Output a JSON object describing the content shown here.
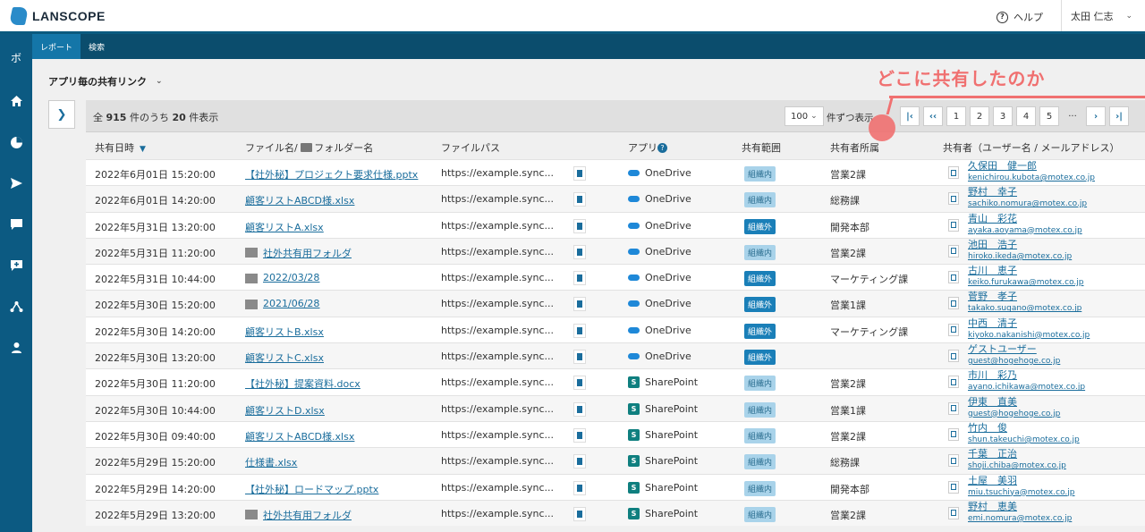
{
  "header": {
    "brand": "LANSCOPE",
    "help_label": "ヘルプ",
    "user_name": "太田 仁志"
  },
  "sidebar": {
    "top_label": "ボ",
    "items": [
      "home-icon",
      "chart-icon",
      "send-icon",
      "chat-icon",
      "add-comment-icon",
      "network-icon",
      "person-icon"
    ]
  },
  "subnav": {
    "tabs": [
      {
        "label": "レポート",
        "active": true
      },
      {
        "label": "検索",
        "active": false
      }
    ]
  },
  "page": {
    "title": "アプリ毎の共有リンク",
    "count_prefix": "全",
    "total": "915",
    "count_middle": "件のうち",
    "shown": "20",
    "count_suffix": "件表示",
    "per_page": "100",
    "per_page_label": "件ずつ表示",
    "pages": [
      "1",
      "2",
      "3",
      "4",
      "5"
    ],
    "ellipsis": "···"
  },
  "callout": {
    "text": "どこに共有したのか",
    "color": "#f07070"
  },
  "table": {
    "headers": {
      "date": "共有日時",
      "file": "ファイル名/",
      "folder": "フォルダー名",
      "path": "ファイルパス",
      "app": "アプリ",
      "scope": "共有範囲",
      "dept": "共有者所属",
      "sharer": "共有者（ユーザー名 / メールアドレス）"
    },
    "rows": [
      {
        "date": "2022年6月01日 15:20:00",
        "file": "【社外秘】プロジェクト要求仕様.pptx",
        "folder": false,
        "path": "https://example.sync...",
        "app": "OneDrive",
        "scope": "組織内",
        "dept": "営業2課",
        "name": "久保田　健一郎",
        "mail": "kenichirou.kubota@motex.co.jp"
      },
      {
        "date": "2022年6月01日 14:20:00",
        "file": "顧客リストABCD様.xlsx",
        "folder": false,
        "path": "https://example.sync...",
        "app": "OneDrive",
        "scope": "組織内",
        "dept": "総務課",
        "name": "野村　幸子",
        "mail": "sachiko.nomura@motex.co.jp"
      },
      {
        "date": "2022年5月31日 13:20:00",
        "file": "顧客リストA.xlsx",
        "folder": false,
        "path": "https://example.sync...",
        "app": "OneDrive",
        "scope": "組織外",
        "dept": "開発本部",
        "name": "青山　彩花",
        "mail": "ayaka.aoyama@motex.co.jp"
      },
      {
        "date": "2022年5月31日 11:20:00",
        "file": "社外共有用フォルダ",
        "folder": true,
        "path": "https://example.sync...",
        "app": "OneDrive",
        "scope": "組織内",
        "dept": "営業2課",
        "name": "池田　浩子",
        "mail": "hiroko.ikeda@motex.co.jp"
      },
      {
        "date": "2022年5月31日 10:44:00",
        "file": "2022/03/28",
        "folder": true,
        "path": "https://example.sync...",
        "app": "OneDrive",
        "scope": "組織外",
        "dept": "マーケティング課",
        "name": "古川　恵子",
        "mail": "keiko.furukawa@motex.co.jp"
      },
      {
        "date": "2022年5月30日 15:20:00",
        "file": "2021/06/28",
        "folder": true,
        "path": "https://example.sync...",
        "app": "OneDrive",
        "scope": "組織外",
        "dept": "営業1課",
        "name": "菅野　孝子",
        "mail": "takako.sugano@motex.co.jp"
      },
      {
        "date": "2022年5月30日 14:20:00",
        "file": "顧客リストB.xlsx",
        "folder": false,
        "path": "https://example.sync...",
        "app": "OneDrive",
        "scope": "組織外",
        "dept": "マーケティング課",
        "name": "中西　清子",
        "mail": "kiyoko.nakanishi@motex.co.jp"
      },
      {
        "date": "2022年5月30日 13:20:00",
        "file": "顧客リストC.xlsx",
        "folder": false,
        "path": "https://example.sync...",
        "app": "OneDrive",
        "scope": "組織外",
        "dept": "",
        "name": "ゲストユーザー",
        "mail": "guest@hogehoge.co.jp"
      },
      {
        "date": "2022年5月30日 11:20:00",
        "file": "【社外秘】提案資料.docx",
        "folder": false,
        "path": "https://example.sync...",
        "app": "SharePoint",
        "scope": "組織内",
        "dept": "営業2課",
        "name": "市川　彩乃",
        "mail": "ayano.ichikawa@motex.co.jp"
      },
      {
        "date": "2022年5月30日 10:44:00",
        "file": "顧客リストD.xlsx",
        "folder": false,
        "path": "https://example.sync...",
        "app": "SharePoint",
        "scope": "組織内",
        "dept": "営業1課",
        "name": "伊東　直美",
        "mail": "guest@hogehoge.co.jp"
      },
      {
        "date": "2022年5月30日 09:40:00",
        "file": "顧客リストABCD様.xlsx",
        "folder": false,
        "path": "https://example.sync...",
        "app": "SharePoint",
        "scope": "組織内",
        "dept": "営業2課",
        "name": "竹内　俊",
        "mail": "shun.takeuchi@motex.co.jp"
      },
      {
        "date": "2022年5月29日 15:20:00",
        "file": "仕様書.xlsx",
        "folder": false,
        "path": "https://example.sync...",
        "app": "SharePoint",
        "scope": "組織内",
        "dept": "総務課",
        "name": "千葉　正治",
        "mail": "shoji.chiba@motex.co.jp"
      },
      {
        "date": "2022年5月29日 14:20:00",
        "file": "【社外秘】ロードマップ.pptx",
        "folder": false,
        "path": "https://example.sync...",
        "app": "SharePoint",
        "scope": "組織内",
        "dept": "開発本部",
        "name": "土屋　美羽",
        "mail": "miu.tsuchiya@motex.co.jp"
      },
      {
        "date": "2022年5月29日 13:20:00",
        "file": "社外共有用フォルダ",
        "folder": true,
        "path": "https://example.sync...",
        "app": "SharePoint",
        "scope": "組織内",
        "dept": "営業2課",
        "name": "野村　恵美",
        "mail": "emi.nomura@motex.co.jp"
      }
    ]
  }
}
